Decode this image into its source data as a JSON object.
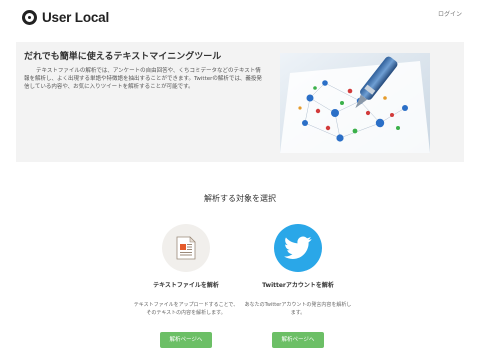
{
  "header": {
    "logo_text": "User Local",
    "login_label": "ログイン"
  },
  "hero": {
    "title": "だれでも簡単に使えるテキストマイニングツール",
    "description": "テキストファイルの解析では、アンケートの自由回答や、くちコミデータなどのテキスト情報を解析し、よく出現する単語や特徴語を抽出することができます。Twitterの解析では、義投発信している内容や、お気に入りツイートを解析することが可能です。"
  },
  "main": {
    "section_title": "解析する対象を選択",
    "cards": [
      {
        "icon": "document-icon",
        "title": "テキストファイルを解析",
        "description": "テキストファイルをアップロードすることで、そのテキストの内容を解析します。",
        "button_label": "解析ページへ"
      },
      {
        "icon": "twitter-bird-icon",
        "title": "Twitterアカウントを解析",
        "description": "あなたのTwitterアカウントの発言内容を解析します。",
        "button_label": "解析ページへ"
      }
    ]
  },
  "colors": {
    "button_green": "#6cbf66",
    "twitter_blue": "#2aa7e8",
    "hero_bg": "#f3f3f3"
  }
}
